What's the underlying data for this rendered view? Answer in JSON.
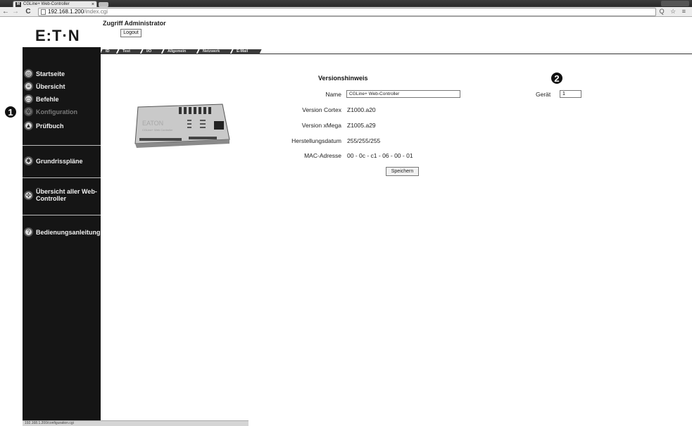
{
  "browser": {
    "tab_title": "CGLine+ Web-Controller",
    "tab_close": "×",
    "favicon": "M",
    "url_host": "192.168.1.200",
    "url_path": "/index.cgi",
    "back": "←",
    "forward": "→",
    "reload": "C",
    "toolbar_right": "Q ☆ ≡"
  },
  "header": {
    "logo": "E:T·N",
    "access_label": "Zugriff Administrator",
    "logout_label": "Logout"
  },
  "tabs": [
    {
      "label": "ID"
    },
    {
      "label": "Test"
    },
    {
      "label": "I/O"
    },
    {
      "label": "Allgemein"
    },
    {
      "label": "Netzwerk"
    },
    {
      "label": "E-Mail"
    }
  ],
  "sidebar": {
    "items": [
      {
        "label": "Startseite",
        "icon": "globe-icon"
      },
      {
        "label": "Übersicht",
        "icon": "list-icon"
      },
      {
        "label": "Befehle",
        "icon": "command-icon"
      },
      {
        "label": "Konfiguration",
        "icon": "gears-icon",
        "disabled": true
      },
      {
        "label": "Prüfbuch",
        "icon": "warning-icon"
      },
      {
        "label": "Grundrisspläne",
        "icon": "floorplan-icon"
      },
      {
        "label": "Übersicht aller Web-Controller",
        "icon": "network-icon"
      },
      {
        "label": "Bedienungsanleitung",
        "icon": "help-icon"
      }
    ]
  },
  "callouts": {
    "one": "1",
    "two": "2"
  },
  "form": {
    "title": "Versionshinweis",
    "name_label": "Name",
    "name_value": "CGLine+ Web-Controller",
    "device_label": "Gerät",
    "device_value": "1",
    "rows": [
      {
        "label": "Version Cortex",
        "value": "Z1000.a20"
      },
      {
        "label": "Version xMega",
        "value": "Z1005.a29"
      },
      {
        "label": "Herstellungsdatum",
        "value": "255/255/255"
      },
      {
        "label": "MAC-Adresse",
        "value": "00 - 0c - c1 - 06 - 00 - 01"
      }
    ],
    "save_label": "Speichern"
  },
  "device_image": {
    "brand": "EATON",
    "model": "CGLine+ Web Controller"
  },
  "status_bar": "192.168.1.200/configuration.cgi"
}
